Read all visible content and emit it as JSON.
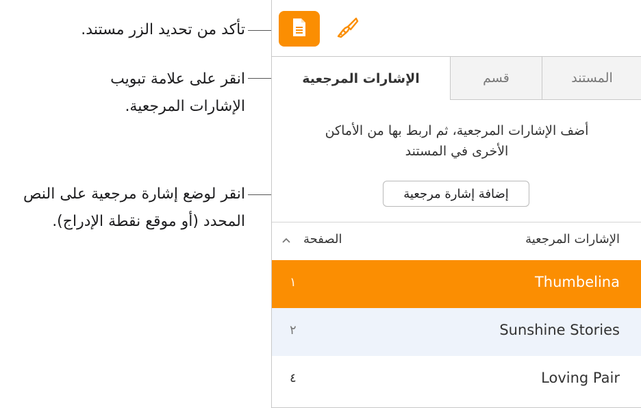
{
  "callouts": {
    "doc_button": "تأكد من تحديد الزر مستند.",
    "bookmarks_tab_line1": "انقر على علامة تبويب",
    "bookmarks_tab_line2": "الإشارات المرجعية.",
    "add_bookmark_line1": "انقر لوضع إشارة مرجعية على النص",
    "add_bookmark_line2": "المحدد (أو موقع نقطة الإدراج)."
  },
  "toolbar": {
    "document_icon": "document-icon",
    "format_icon": "paintbrush-icon"
  },
  "tabs": [
    {
      "label": "الإشارات المرجعية",
      "selected": true
    },
    {
      "label": "قسم",
      "selected": false
    },
    {
      "label": "المستند",
      "selected": false
    }
  ],
  "bookmarks_pane": {
    "description_line1": "أضف الإشارات المرجعية، ثم اربط بها من الأماكن",
    "description_line2": "الأخرى في المستند",
    "add_button": "إضافة إشارة مرجعية",
    "columns": {
      "bookmarks": "الإشارات المرجعية",
      "page": "الصفحة"
    },
    "sort_icon": "chevron-up-icon",
    "rows": [
      {
        "name": "Thumbelina",
        "page": "١",
        "selected": true
      },
      {
        "name": "Sunshine Stories",
        "page": "٢",
        "selected": false
      },
      {
        "name": "Loving Pair",
        "page": "٤",
        "selected": false
      }
    ]
  },
  "colors": {
    "accent": "#fb8e02",
    "row_alt": "#eef3fb",
    "tab_inactive": "#f3f3f3"
  }
}
